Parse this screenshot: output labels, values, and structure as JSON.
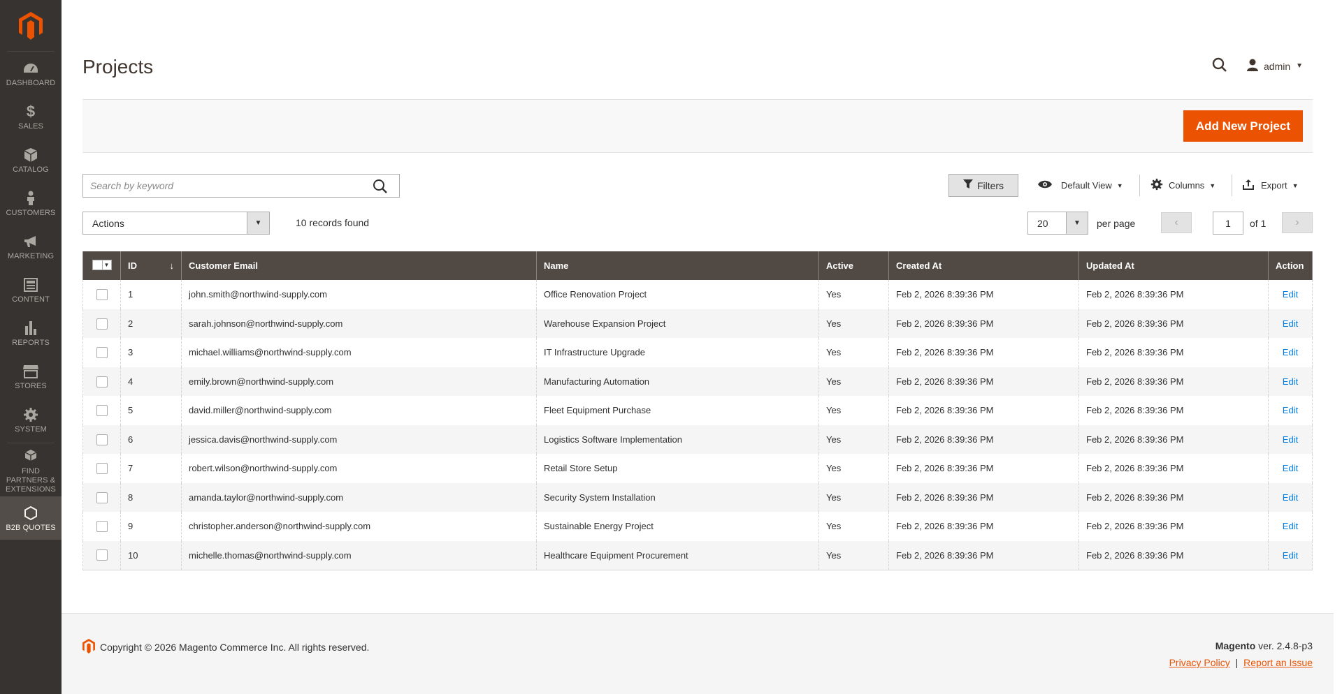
{
  "sidebar": {
    "items": [
      {
        "label": "Dashboard",
        "icon": "dashboard-icon"
      },
      {
        "label": "Sales",
        "icon": "dollar-icon"
      },
      {
        "label": "Catalog",
        "icon": "box-icon"
      },
      {
        "label": "Customers",
        "icon": "person-icon"
      },
      {
        "label": "Marketing",
        "icon": "megaphone-icon"
      },
      {
        "label": "Content",
        "icon": "content-icon"
      },
      {
        "label": "Reports",
        "icon": "bar-chart-icon"
      },
      {
        "label": "Stores",
        "icon": "store-icon"
      },
      {
        "label": "System",
        "icon": "gear-icon"
      },
      {
        "label": "Find Partners & Extensions",
        "icon": "boxes-icon"
      },
      {
        "label": "B2B Quotes",
        "icon": "hexagon-icon"
      }
    ]
  },
  "header": {
    "title": "Projects",
    "user": "admin"
  },
  "action_bar": {
    "add_button": "Add New Project"
  },
  "toolbar": {
    "search_placeholder": "Search by keyword",
    "filters": "Filters",
    "view": "Default View",
    "columns": "Columns",
    "export": "Export",
    "actions": "Actions",
    "records_found": "10 records found",
    "per_page_value": "20",
    "per_page_label": "per page",
    "current_page": "1",
    "total_pages": "of 1"
  },
  "grid": {
    "headers": {
      "id": "ID",
      "email": "Customer Email",
      "name": "Name",
      "active": "Active",
      "created": "Created At",
      "updated": "Updated At",
      "action": "Action"
    },
    "rows": [
      {
        "id": "1",
        "email": "john.smith@northwind-supply.com",
        "name": "Office Renovation Project",
        "active": "Yes",
        "created": "Feb 2, 2026 8:39:36 PM",
        "updated": "Feb 2, 2026 8:39:36 PM",
        "action": "Edit"
      },
      {
        "id": "2",
        "email": "sarah.johnson@northwind-supply.com",
        "name": "Warehouse Expansion Project",
        "active": "Yes",
        "created": "Feb 2, 2026 8:39:36 PM",
        "updated": "Feb 2, 2026 8:39:36 PM",
        "action": "Edit"
      },
      {
        "id": "3",
        "email": "michael.williams@northwind-supply.com",
        "name": "IT Infrastructure Upgrade",
        "active": "Yes",
        "created": "Feb 2, 2026 8:39:36 PM",
        "updated": "Feb 2, 2026 8:39:36 PM",
        "action": "Edit"
      },
      {
        "id": "4",
        "email": "emily.brown@northwind-supply.com",
        "name": "Manufacturing Automation",
        "active": "Yes",
        "created": "Feb 2, 2026 8:39:36 PM",
        "updated": "Feb 2, 2026 8:39:36 PM",
        "action": "Edit"
      },
      {
        "id": "5",
        "email": "david.miller@northwind-supply.com",
        "name": "Fleet Equipment Purchase",
        "active": "Yes",
        "created": "Feb 2, 2026 8:39:36 PM",
        "updated": "Feb 2, 2026 8:39:36 PM",
        "action": "Edit"
      },
      {
        "id": "6",
        "email": "jessica.davis@northwind-supply.com",
        "name": "Logistics Software Implementation",
        "active": "Yes",
        "created": "Feb 2, 2026 8:39:36 PM",
        "updated": "Feb 2, 2026 8:39:36 PM",
        "action": "Edit"
      },
      {
        "id": "7",
        "email": "robert.wilson@northwind-supply.com",
        "name": "Retail Store Setup",
        "active": "Yes",
        "created": "Feb 2, 2026 8:39:36 PM",
        "updated": "Feb 2, 2026 8:39:36 PM",
        "action": "Edit"
      },
      {
        "id": "8",
        "email": "amanda.taylor@northwind-supply.com",
        "name": "Security System Installation",
        "active": "Yes",
        "created": "Feb 2, 2026 8:39:36 PM",
        "updated": "Feb 2, 2026 8:39:36 PM",
        "action": "Edit"
      },
      {
        "id": "9",
        "email": "christopher.anderson@northwind-supply.com",
        "name": "Sustainable Energy Project",
        "active": "Yes",
        "created": "Feb 2, 2026 8:39:36 PM",
        "updated": "Feb 2, 2026 8:39:36 PM",
        "action": "Edit"
      },
      {
        "id": "10",
        "email": "michelle.thomas@northwind-supply.com",
        "name": "Healthcare Equipment Procurement",
        "active": "Yes",
        "created": "Feb 2, 2026 8:39:36 PM",
        "updated": "Feb 2, 2026 8:39:36 PM",
        "action": "Edit"
      }
    ]
  },
  "footer": {
    "copyright": "Copyright © 2026 Magento Commerce Inc. All rights reserved.",
    "brand": "Magento",
    "version": " ver. 2.4.8-p3",
    "privacy": "Privacy Policy",
    "separator": "|",
    "report": "Report an Issue"
  },
  "colors": {
    "accent": "#eb5202",
    "sidebar": "#373330",
    "grid_header": "#514943",
    "link": "#007bdb"
  }
}
